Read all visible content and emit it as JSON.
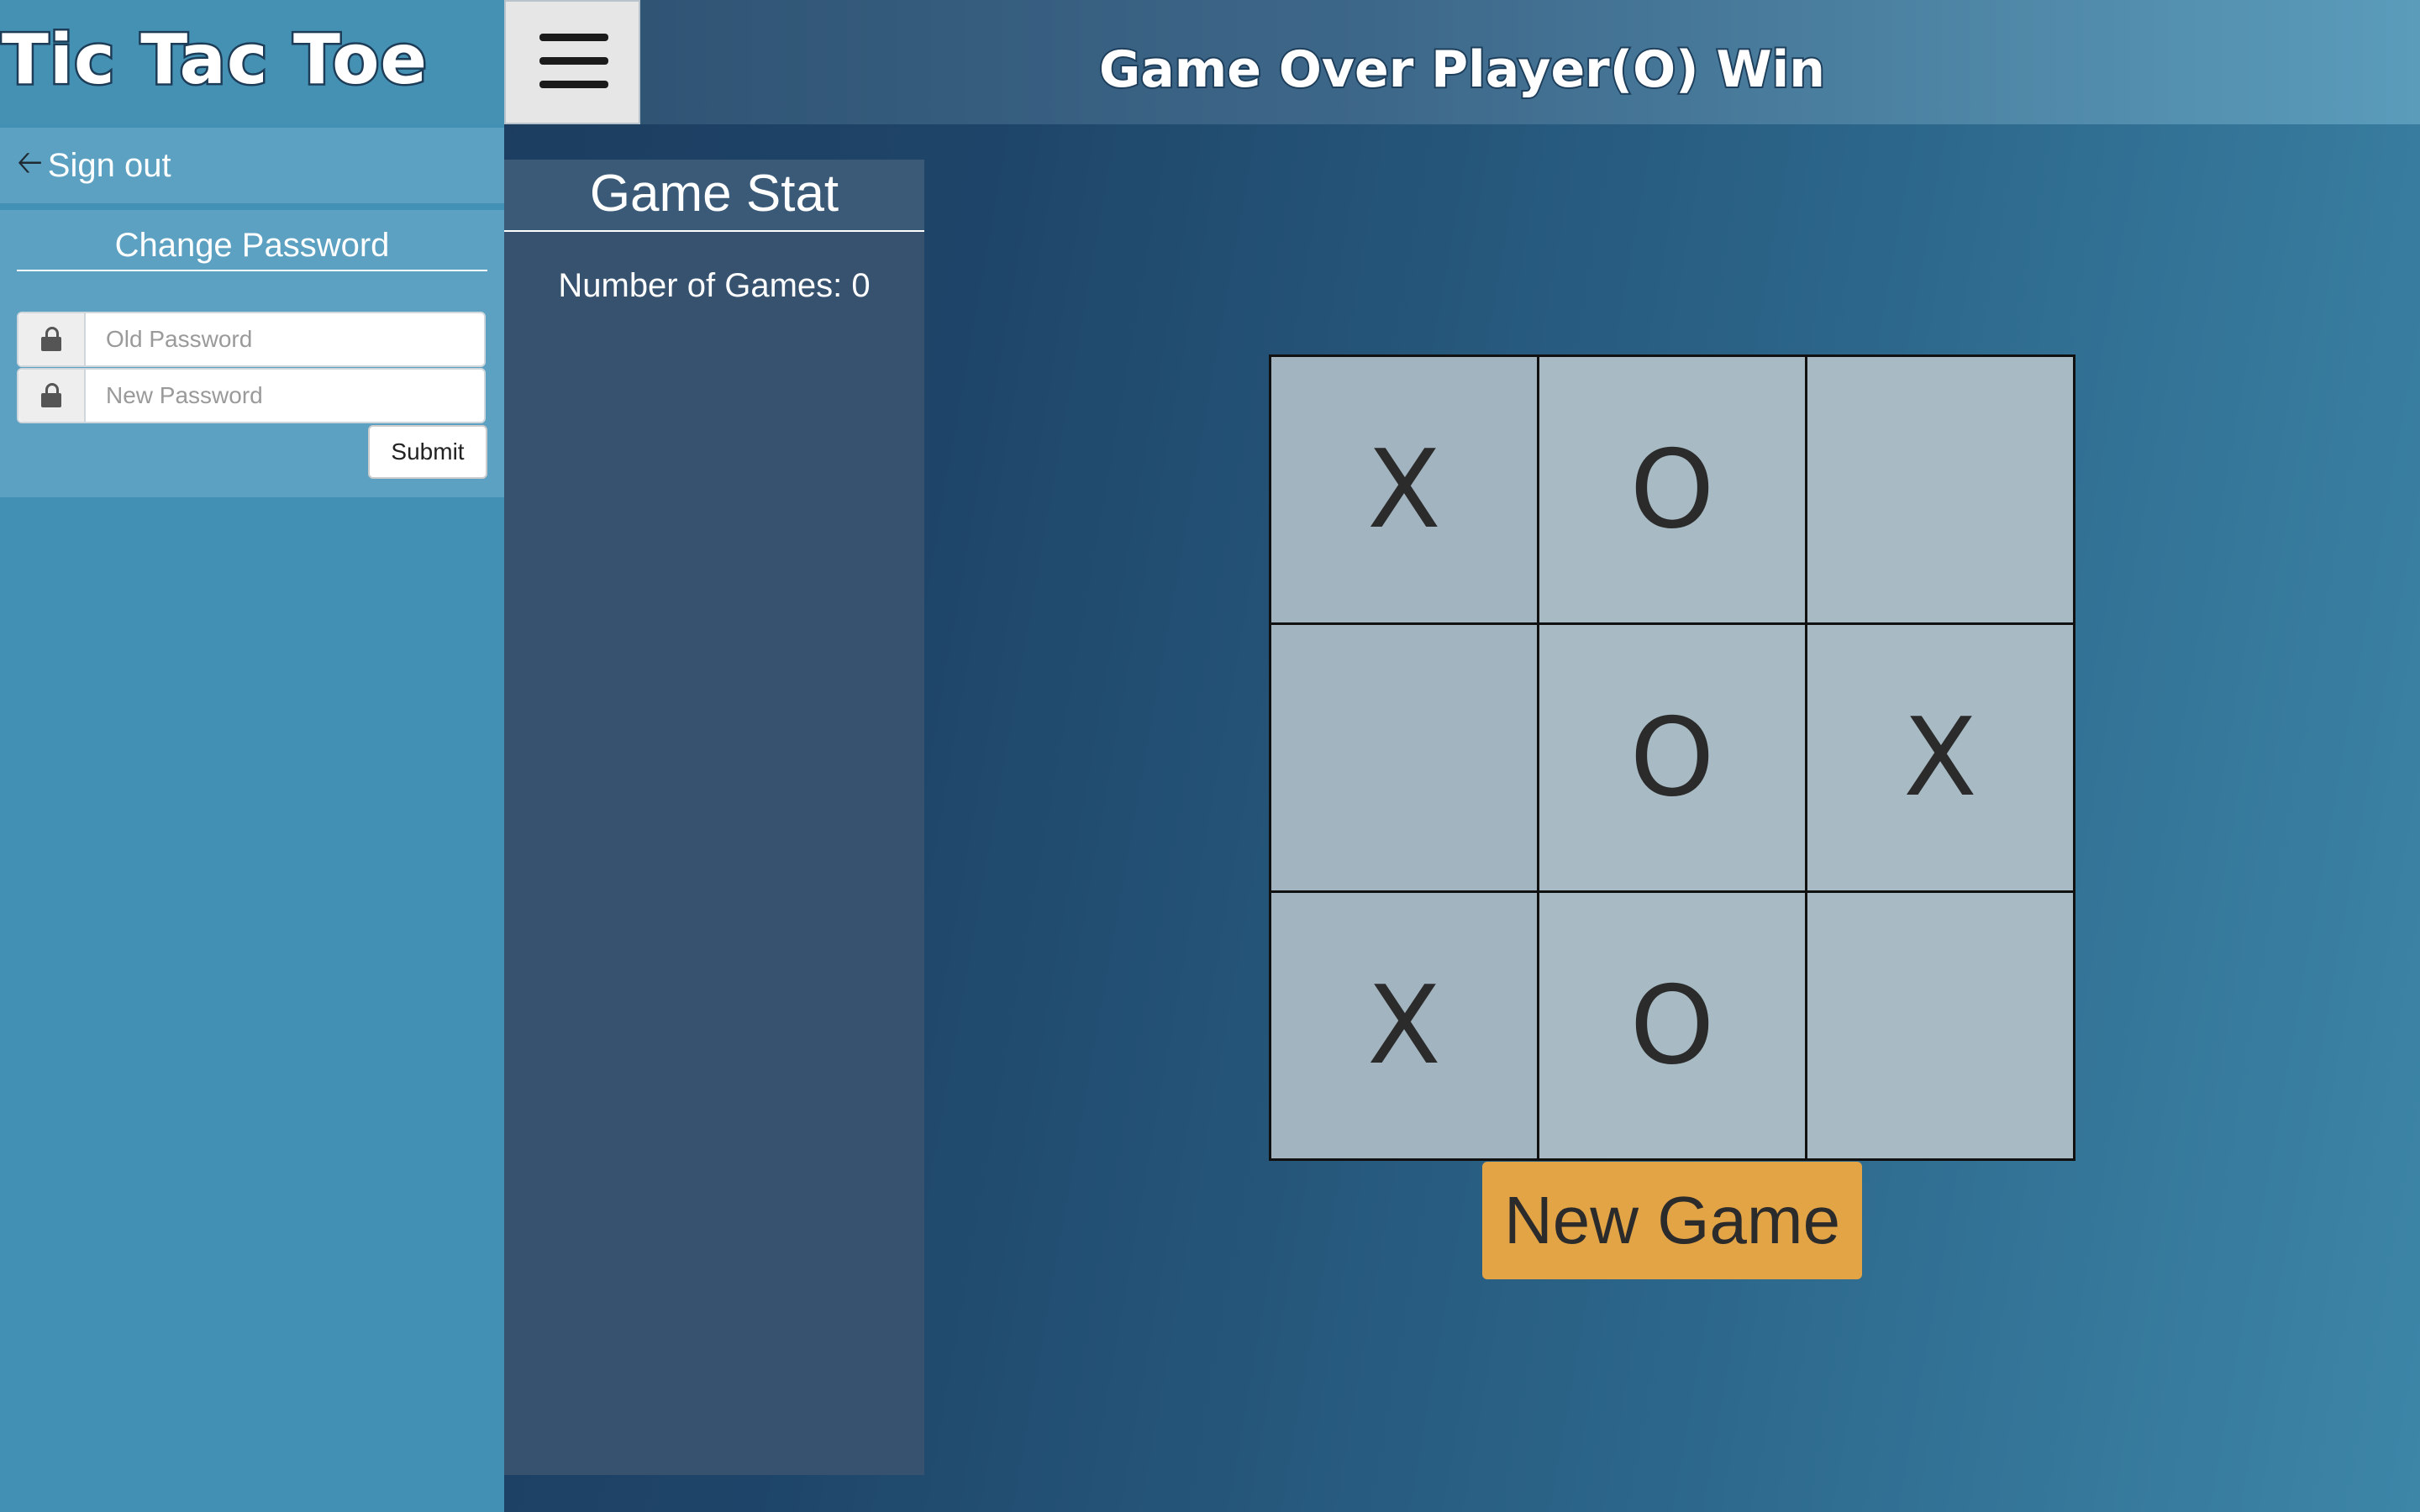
{
  "app": {
    "title": "Tic Tac Toe"
  },
  "header": {
    "status": "Game Over Player(O) Win",
    "menu_icon": "hamburger-menu-icon"
  },
  "sidebar": {
    "sign_out_label": "Sign out",
    "sign_out_icon": "arrow-left-icon",
    "change_password": {
      "title": "Change Password",
      "old_password_placeholder": "Old Password",
      "old_password_value": "",
      "new_password_placeholder": "New Password",
      "new_password_value": "",
      "field_icon": "lock-icon",
      "submit_label": "Submit"
    }
  },
  "stats": {
    "title": "Game Stat",
    "games_label": "Number of Games:",
    "games_count": "0"
  },
  "board": {
    "cells": [
      "X",
      "O",
      "",
      "",
      "O",
      "X",
      "X",
      "O",
      ""
    ]
  },
  "actions": {
    "new_game_label": "New Game"
  },
  "colors": {
    "sidebar": "#4290b3",
    "panel": "#5ca1c1",
    "stat_panel": "#36526f",
    "board_cell": "#a8bbc5",
    "new_game_button": "#e3a446"
  }
}
